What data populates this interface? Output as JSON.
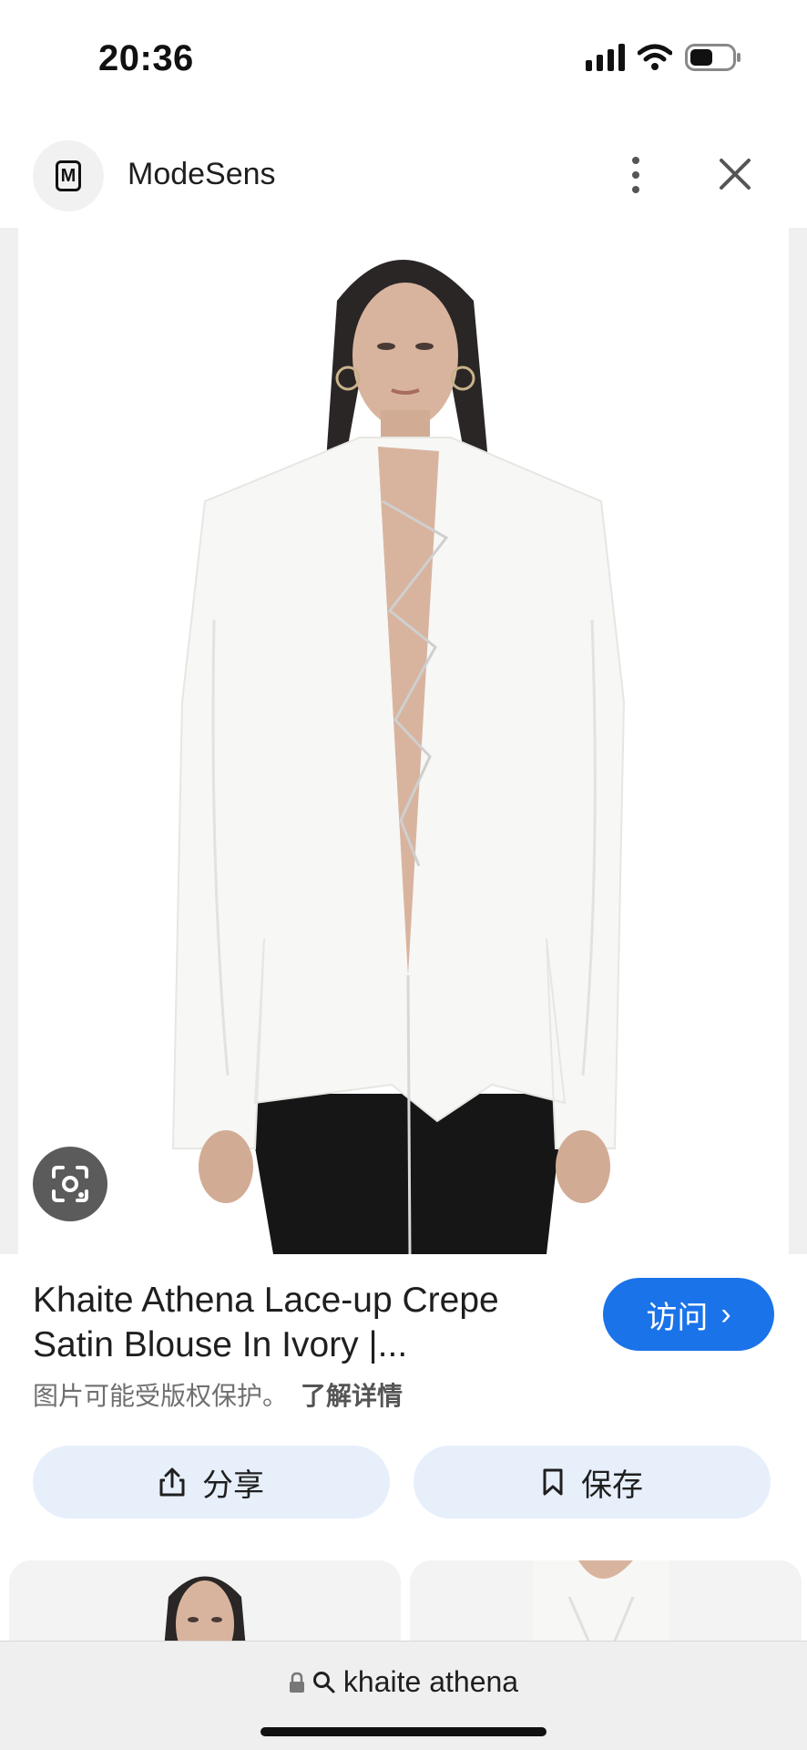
{
  "status_bar": {
    "time": "20:36",
    "battery_level": 0.55
  },
  "header": {
    "site_name": "ModeSens",
    "logo_letter": "M"
  },
  "product": {
    "title": "Khaite Athena Lace-up Crepe Satin Blouse In Ivory |...",
    "image_alt": "Model wearing ivory lace-up satin blouse"
  },
  "visit_button": {
    "label": "访问",
    "chevron": "›"
  },
  "copyright": {
    "notice": "图片可能受版权保护。",
    "learn_more": "了解详情"
  },
  "actions": {
    "share_label": "分享",
    "save_label": "保存"
  },
  "bottom_bar": {
    "url_text": "khaite athena"
  },
  "colors": {
    "accent": "#1a73e8",
    "action_bg": "#e7effb",
    "lens_bg": "#5b5b5b"
  },
  "icons": [
    "signal-icon",
    "wifi-icon",
    "battery-icon",
    "more-vert-icon",
    "close-icon",
    "google-lens-icon",
    "share-icon",
    "bookmark-icon",
    "lock-icon",
    "search-icon"
  ]
}
